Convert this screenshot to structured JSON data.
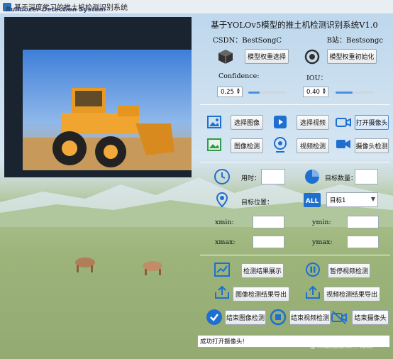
{
  "window": {
    "title": "基于深度学习的推土机检测识别系统",
    "overlay_title": "Bulldozer Detection System"
  },
  "header": {
    "title": "基于YOLOv5模型的推土机检测识别系统V1.0",
    "csdn": "CSDN：BestSongC",
    "bilibili": "B站：Bestsongc"
  },
  "model": {
    "select_label": "模型权重选择",
    "init_label": "模型权重初始化",
    "confidence_label": "Confidence:",
    "iou_label": "IOU：",
    "confidence_value": "0.25",
    "iou_value": "0.40",
    "confidence_level": 0.25,
    "iou_level": 0.4
  },
  "sources": {
    "select_image": "选择图像",
    "select_video": "选择视频",
    "open_camera": "打开摄像头",
    "image_detect": "图像检测",
    "video_detect": "视频检测",
    "camera_detect": "摄像头检测"
  },
  "results": {
    "time_label": "用时：",
    "count_label": "目标数量：",
    "position_label": "目标位置：",
    "target_select": "目标1",
    "xmin_label": "xmin:",
    "ymin_label": "ymin:",
    "xmax_label": "xmax:",
    "ymax_label": "ymax:"
  },
  "actions": {
    "show_results": "检测结果展示",
    "pause_video": "暂停视频检测",
    "export_image": "图像检测结果导出",
    "export_video": "视频检测结果导出",
    "end_image": "结束图像检测",
    "end_video": "结束视频检测",
    "end_camera": "结束摄像头"
  },
  "status": {
    "message": "成功打开摄像头!"
  },
  "watermark": "@稀土掘金技术社区",
  "colors": {
    "accent": "#2f7fd8",
    "icon_blue": "#1f6fd1"
  }
}
